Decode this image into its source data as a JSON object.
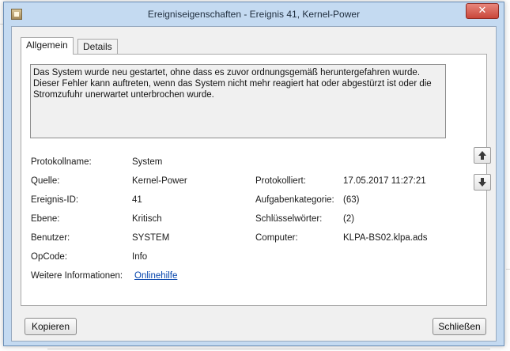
{
  "window": {
    "title": "Ereigniseigenschaften - Ereignis 41, Kernel-Power",
    "close_glyph": "✕"
  },
  "tabs": [
    {
      "label": "Allgemein",
      "active": true
    },
    {
      "label": "Details",
      "active": false
    }
  ],
  "description": "Das System wurde neu gestartet, ohne dass es zuvor ordnungsgemäß heruntergefahren wurde. Dieser Fehler kann auftreten, wenn das System nicht mehr reagiert hat oder abgestürzt ist oder die Stromzufuhr unerwartet unterbrochen wurde.",
  "fields": {
    "protokollname": {
      "label": "Protokollname:",
      "value": "System"
    },
    "quelle": {
      "label": "Quelle:",
      "value": "Kernel-Power"
    },
    "ereignis_id": {
      "label": "Ereignis-ID:",
      "value": "41"
    },
    "ebene": {
      "label": "Ebene:",
      "value": "Kritisch"
    },
    "benutzer": {
      "label": "Benutzer:",
      "value": "SYSTEM"
    },
    "opcode": {
      "label": "OpCode:",
      "value": "Info"
    },
    "weitere": {
      "label": "Weitere Informationen:",
      "value": "Onlinehilfe"
    },
    "protokolliert": {
      "label": "Protokolliert:",
      "value": "17.05.2017 11:27:21"
    },
    "aufgabenkategorie": {
      "label": "Aufgabenkategorie:",
      "value": "(63)"
    },
    "schluesselwoerter": {
      "label": "Schlüsselwörter:",
      "value": "(2)"
    },
    "computer": {
      "label": "Computer:",
      "value": "KLPA-BS02.klpa.ads"
    }
  },
  "buttons": {
    "copy": "Kopieren",
    "close": "Schließen"
  },
  "icons": {
    "up": "arrow-up-icon",
    "down": "arrow-down-icon",
    "app": "event-viewer-icon"
  }
}
